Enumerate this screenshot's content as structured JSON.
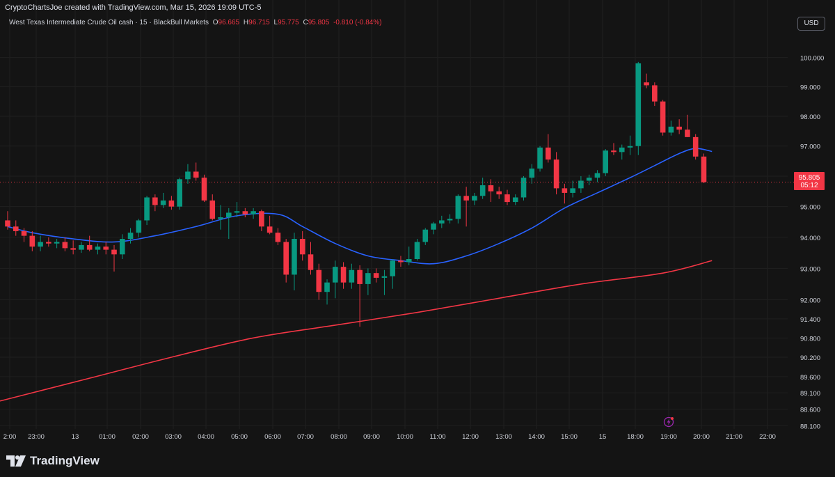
{
  "header": {
    "credit": "CryptoChartsJoe created with TradingView.com, Mar 15, 2026 19:09 UTC-5",
    "symbol": "West Texas Intermediate Crude Oil cash · 15 · BlackBull Markets",
    "open_label": "O",
    "open_value": "96.665",
    "high_label": "H",
    "high_value": "96.715",
    "low_label": "L",
    "low_value": "95.775",
    "close_label": "C",
    "close_value": "95.805",
    "change": "-0.810 (-0.84%)"
  },
  "currency_button": "USD",
  "brand": "TradingView",
  "price_tag": {
    "value": "95.805",
    "countdown": "05:12"
  },
  "colors": {
    "up": "#089981",
    "down": "#f23645",
    "ma_fast": "#2962ff",
    "ma_slow": "#f23645",
    "background": "#141414",
    "grid": "#1f1f1f",
    "axis_text": "#d1d4dc"
  },
  "icons": {
    "logo": "tradingview-logo-icon",
    "alert": "lightning-alert-icon"
  },
  "chart_data": {
    "type": "candlestick",
    "y_scale": "log",
    "y_range": [
      88.0,
      100.4
    ],
    "y_ticks": [
      "100.000",
      "99.000",
      "98.000",
      "97.000",
      "96.000",
      "95.000",
      "94.000",
      "93.000",
      "92.000",
      "91.400",
      "90.800",
      "90.200",
      "89.600",
      "89.100",
      "88.600",
      "88.100"
    ],
    "x_ticks": [
      "2:00",
      "23:00",
      "13",
      "01:00",
      "02:00",
      "03:00",
      "04:00",
      "05:00",
      "06:00",
      "07:00",
      "08:00",
      "09:00",
      "10:00",
      "11:00",
      "12:00",
      "13:00",
      "14:00",
      "15:00",
      "15",
      "18:00",
      "19:00",
      "20:00",
      "21:00",
      "22:00"
    ],
    "last_price": 95.805,
    "candles": [
      [
        94.55,
        94.85,
        94.25,
        94.35
      ],
      [
        94.35,
        94.55,
        94.05,
        94.2
      ],
      [
        94.2,
        94.3,
        93.85,
        94.05
      ],
      [
        94.05,
        94.2,
        93.55,
        93.7
      ],
      [
        93.7,
        94.05,
        93.55,
        93.85
      ],
      [
        93.85,
        94.0,
        93.7,
        93.8
      ],
      [
        93.8,
        93.95,
        93.65,
        93.85
      ],
      [
        93.85,
        94.0,
        93.55,
        93.65
      ],
      [
        93.65,
        93.9,
        93.45,
        93.6
      ],
      [
        93.6,
        93.85,
        93.5,
        93.75
      ],
      [
        93.75,
        94.05,
        93.55,
        93.6
      ],
      [
        93.6,
        93.8,
        93.45,
        93.7
      ],
      [
        93.7,
        93.85,
        93.45,
        93.6
      ],
      [
        93.6,
        93.75,
        92.9,
        93.45
      ],
      [
        93.45,
        94.1,
        93.3,
        93.95
      ],
      [
        93.95,
        94.3,
        93.8,
        94.15
      ],
      [
        94.15,
        94.6,
        94.0,
        94.55
      ],
      [
        94.55,
        95.35,
        94.4,
        95.3
      ],
      [
        95.3,
        95.4,
        94.85,
        95.05
      ],
      [
        95.05,
        95.45,
        94.95,
        95.2
      ],
      [
        95.2,
        95.35,
        94.9,
        95.0
      ],
      [
        95.0,
        95.95,
        94.9,
        95.9
      ],
      [
        95.9,
        96.4,
        95.75,
        96.15
      ],
      [
        96.15,
        96.45,
        95.85,
        95.95
      ],
      [
        95.95,
        96.05,
        95.15,
        95.2
      ],
      [
        95.2,
        95.4,
        94.55,
        94.6
      ],
      [
        94.6,
        95.05,
        94.25,
        94.65
      ],
      [
        94.65,
        94.95,
        93.95,
        94.8
      ],
      [
        94.8,
        95.15,
        94.65,
        94.85
      ],
      [
        94.85,
        94.95,
        94.65,
        94.75
      ],
      [
        94.75,
        94.95,
        94.6,
        94.85
      ],
      [
        94.85,
        94.9,
        94.2,
        94.35
      ],
      [
        94.35,
        94.7,
        94.1,
        94.15
      ],
      [
        94.15,
        94.3,
        93.75,
        93.85
      ],
      [
        93.85,
        93.95,
        92.55,
        92.8
      ],
      [
        92.8,
        94.15,
        92.3,
        93.95
      ],
      [
        93.95,
        94.2,
        93.25,
        93.45
      ],
      [
        93.45,
        93.85,
        92.8,
        92.95
      ],
      [
        92.95,
        93.15,
        92.0,
        92.25
      ],
      [
        92.25,
        92.65,
        91.85,
        92.55
      ],
      [
        92.55,
        93.25,
        92.05,
        93.05
      ],
      [
        93.05,
        93.2,
        92.35,
        92.55
      ],
      [
        92.55,
        93.15,
        92.35,
        92.95
      ],
      [
        92.95,
        93.1,
        91.15,
        92.5
      ],
      [
        92.5,
        93.0,
        92.15,
        92.85
      ],
      [
        92.85,
        93.0,
        92.55,
        92.7
      ],
      [
        92.7,
        92.95,
        92.15,
        92.75
      ],
      [
        92.75,
        93.3,
        92.35,
        93.25
      ],
      [
        93.25,
        93.4,
        93.05,
        93.2
      ],
      [
        93.2,
        93.7,
        93.1,
        93.3
      ],
      [
        93.3,
        93.95,
        93.25,
        93.85
      ],
      [
        93.85,
        94.3,
        93.75,
        94.25
      ],
      [
        94.25,
        94.5,
        94.1,
        94.45
      ],
      [
        94.45,
        94.7,
        94.3,
        94.55
      ],
      [
        94.55,
        94.75,
        94.45,
        94.6
      ],
      [
        94.6,
        95.4,
        94.45,
        95.35
      ],
      [
        95.35,
        95.65,
        94.35,
        95.2
      ],
      [
        95.2,
        95.45,
        95.05,
        95.35
      ],
      [
        95.35,
        95.95,
        95.25,
        95.7
      ],
      [
        95.7,
        95.9,
        95.15,
        95.5
      ],
      [
        95.5,
        95.65,
        95.25,
        95.4
      ],
      [
        95.4,
        95.55,
        95.05,
        95.15
      ],
      [
        95.15,
        95.4,
        95.05,
        95.3
      ],
      [
        95.3,
        96.0,
        95.2,
        95.95
      ],
      [
        95.95,
        96.4,
        95.75,
        96.25
      ],
      [
        96.25,
        97.0,
        96.15,
        96.95
      ],
      [
        96.95,
        97.4,
        96.45,
        96.55
      ],
      [
        96.55,
        96.8,
        95.4,
        95.6
      ],
      [
        95.6,
        95.75,
        95.1,
        95.45
      ],
      [
        95.45,
        95.85,
        95.3,
        95.6
      ],
      [
        95.6,
        96.0,
        95.45,
        95.85
      ],
      [
        95.85,
        96.05,
        95.7,
        95.95
      ],
      [
        95.95,
        96.2,
        95.8,
        96.1
      ],
      [
        96.1,
        96.9,
        96.0,
        96.85
      ],
      [
        96.85,
        97.1,
        96.7,
        96.8
      ],
      [
        96.8,
        97.05,
        96.55,
        96.95
      ],
      [
        96.95,
        97.35,
        96.7,
        97.0
      ],
      [
        97.0,
        99.85,
        96.7,
        99.8
      ],
      [
        99.15,
        99.45,
        98.95,
        99.05
      ],
      [
        99.05,
        99.15,
        98.35,
        98.5
      ],
      [
        98.5,
        98.55,
        97.35,
        97.45
      ],
      [
        97.45,
        97.85,
        97.35,
        97.65
      ],
      [
        97.65,
        97.9,
        97.4,
        97.55
      ],
      [
        97.55,
        98.05,
        97.3,
        97.3
      ],
      [
        97.3,
        97.4,
        96.55,
        96.65
      ],
      [
        96.65,
        96.75,
        95.77,
        95.8
      ]
    ],
    "ma_fast_points": [
      [
        0,
        94.35
      ],
      [
        3,
        94.15
      ],
      [
        8,
        93.95
      ],
      [
        13,
        93.85
      ],
      [
        18,
        94.05
      ],
      [
        23,
        94.35
      ],
      [
        28,
        94.7
      ],
      [
        33,
        94.75
      ],
      [
        36,
        94.35
      ],
      [
        40,
        93.8
      ],
      [
        44,
        93.4
      ],
      [
        48,
        93.25
      ],
      [
        52,
        93.15
      ],
      [
        56,
        93.4
      ],
      [
        60,
        93.8
      ],
      [
        64,
        94.3
      ],
      [
        68,
        94.95
      ],
      [
        72,
        95.45
      ],
      [
        76,
        95.95
      ],
      [
        79,
        96.35
      ],
      [
        82,
        96.75
      ],
      [
        84,
        96.92
      ],
      [
        86,
        96.82
      ]
    ],
    "ma_slow_points": [
      [
        -1,
        88.85
      ],
      [
        10,
        89.55
      ],
      [
        20,
        90.2
      ],
      [
        30,
        90.8
      ],
      [
        40,
        91.2
      ],
      [
        50,
        91.6
      ],
      [
        60,
        92.05
      ],
      [
        70,
        92.5
      ],
      [
        80,
        92.85
      ],
      [
        86,
        93.25
      ]
    ]
  }
}
